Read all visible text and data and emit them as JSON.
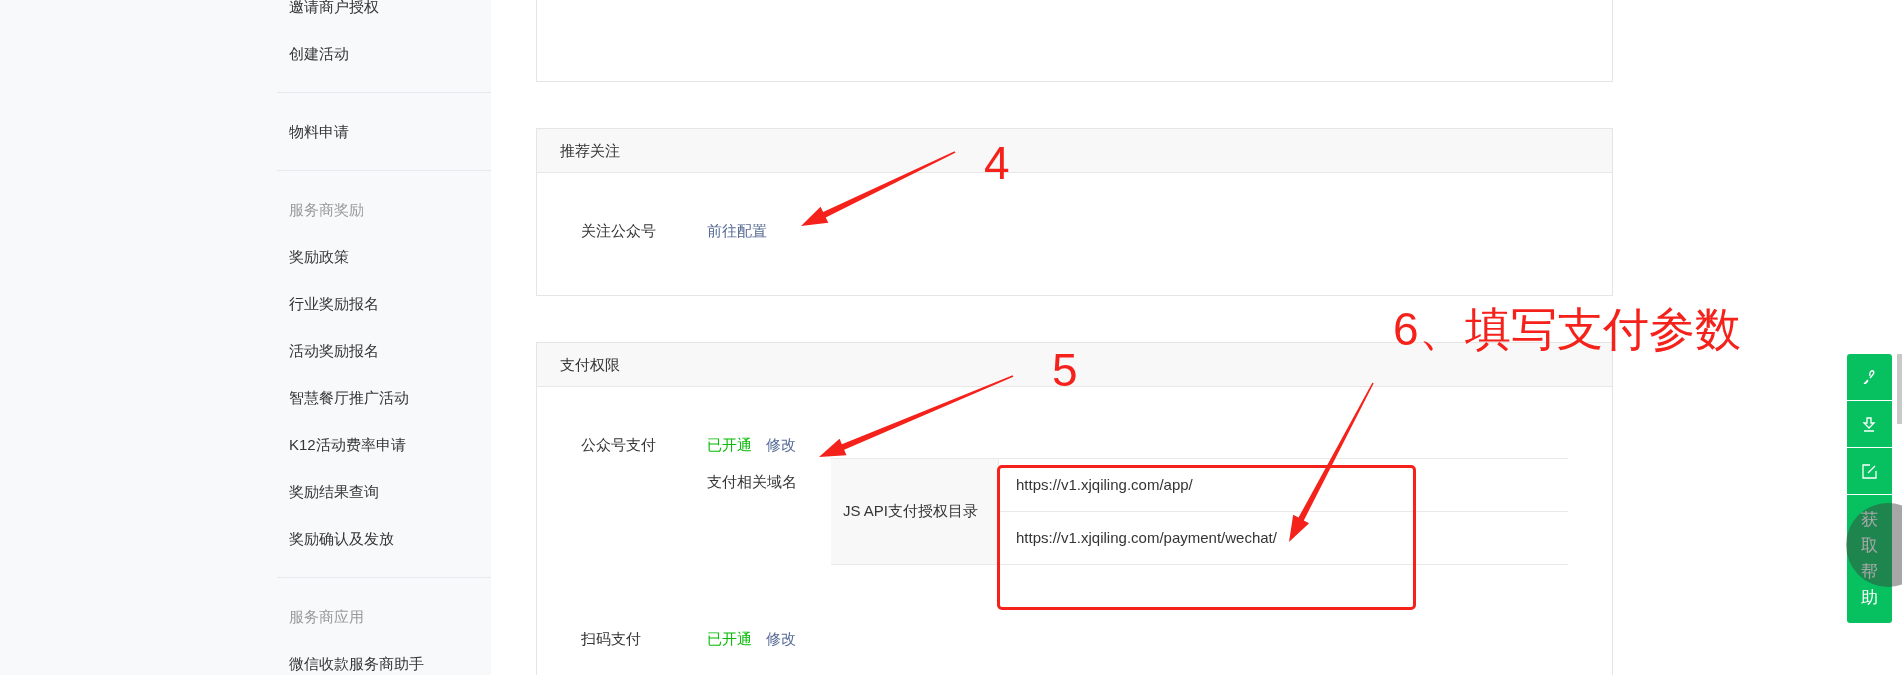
{
  "sidebar": {
    "groups": [
      {
        "items": [
          {
            "label": "邀请商户授权"
          },
          {
            "label": "创建活动"
          }
        ]
      },
      {
        "items": [
          {
            "label": "物料申请"
          }
        ]
      },
      {
        "heading": "服务商奖励",
        "items": [
          {
            "label": "奖励政策"
          },
          {
            "label": "行业奖励报名"
          },
          {
            "label": "活动奖励报名"
          },
          {
            "label": "智慧餐厅推广活动"
          },
          {
            "label": "K12活动费率申请"
          },
          {
            "label": "奖励结果查询"
          },
          {
            "label": "奖励确认及发放"
          }
        ]
      },
      {
        "heading": "服务商应用",
        "items": [
          {
            "label": "微信收款服务商助手"
          }
        ]
      }
    ]
  },
  "cards": [
    {
      "kind": "plain"
    },
    {
      "kind": "titled",
      "title": "推荐关注",
      "rows": [
        {
          "label": "关注公众号",
          "link": "前往配置"
        }
      ]
    },
    {
      "kind": "titled",
      "title": "支付权限",
      "rows": [
        {
          "label": "公众号支付",
          "status": "已开通",
          "link": "修改",
          "domain_label": "支付相关域名",
          "table": {
            "label": "JS API支付授权目录",
            "values": [
              "https://v1.xjqiling.com/app/",
              "https://v1.xjqiling.com/payment/wechat/"
            ]
          }
        },
        {
          "label": "扫码支付",
          "status": "已开通",
          "link": "修改"
        }
      ]
    }
  ],
  "float_toolbar": [
    {
      "kind": "link"
    },
    {
      "kind": "download"
    },
    {
      "kind": "edit"
    },
    {
      "kind": "help",
      "label": "获取帮助"
    }
  ],
  "annotations": [
    {
      "text": "4"
    },
    {
      "text": "5"
    },
    {
      "text": "6、填写支付参数"
    }
  ]
}
